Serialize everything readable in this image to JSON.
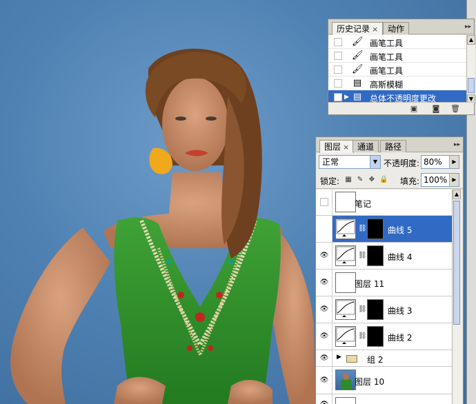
{
  "history_panel": {
    "tabs": [
      {
        "label": "历史记录",
        "close": "×",
        "active": true
      },
      {
        "label": "动作",
        "active": false
      }
    ],
    "items": [
      {
        "label": "画笔工具",
        "icon": "brush-icon",
        "selected": false
      },
      {
        "label": "画笔工具",
        "icon": "brush-icon",
        "selected": false
      },
      {
        "label": "画笔工具",
        "icon": "brush-icon",
        "selected": false
      },
      {
        "label": "高斯模糊",
        "icon": "filter-document-icon",
        "selected": false
      },
      {
        "label": "总体不透明度更改",
        "icon": "filter-document-icon",
        "selected": true
      }
    ],
    "footer_icons": [
      "new-document-from-state-icon",
      "camera-snapshot-icon",
      "trash-icon"
    ]
  },
  "layers_panel": {
    "tabs": [
      {
        "label": "图层",
        "close": "×",
        "active": true
      },
      {
        "label": "通道",
        "active": false
      },
      {
        "label": "路径",
        "active": false
      }
    ],
    "blend_mode": "正常",
    "opacity_label": "不透明度:",
    "opacity_value": "80%",
    "lock_label": "锁定:",
    "fill_label": "填充:",
    "fill_value": "100%",
    "layers": [
      {
        "name": "笔记",
        "type": "empty",
        "visible": false,
        "selected": false
      },
      {
        "name": "曲线 5",
        "type": "curves",
        "visible": true,
        "selected": true
      },
      {
        "name": "曲线 4",
        "type": "curves",
        "visible": true,
        "selected": false
      },
      {
        "name": "图层 11",
        "type": "empty",
        "visible": true,
        "selected": false
      },
      {
        "name": "曲线 3",
        "type": "curves",
        "visible": true,
        "selected": false
      },
      {
        "name": "曲线 2",
        "type": "curves",
        "visible": true,
        "selected": false
      },
      {
        "name": "组 2",
        "type": "group",
        "visible": true,
        "selected": false
      },
      {
        "name": "图层 10",
        "type": "photo",
        "visible": true,
        "selected": false
      }
    ]
  },
  "colors": {
    "background": "#4a7cab",
    "selection": "#316ac5",
    "dress": "#2f8a2a",
    "hair": "#7a4a24",
    "earring": "#f0a91c"
  }
}
